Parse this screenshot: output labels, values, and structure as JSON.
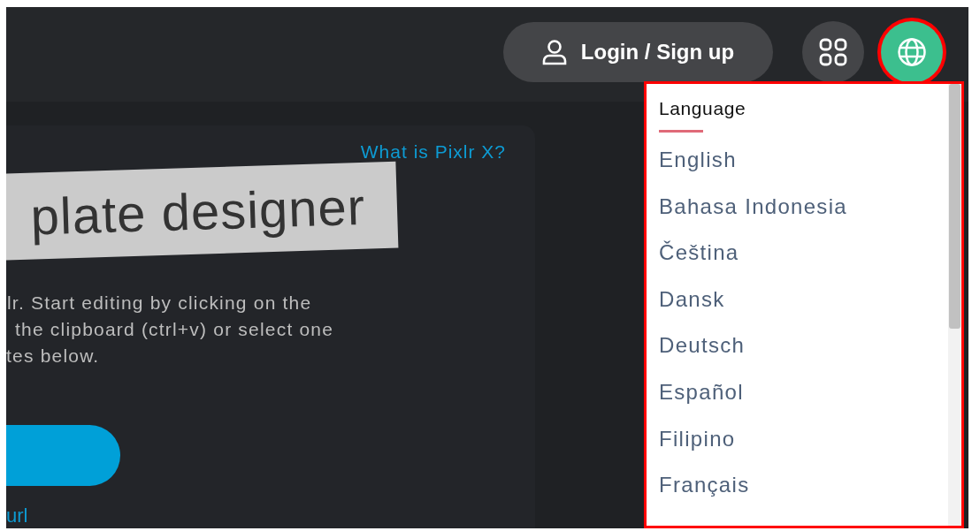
{
  "header": {
    "login_button": "Login / Sign up",
    "language_button": {
      "highlighted": true
    }
  },
  "intro": {
    "help_link": "What is Pixlr X?",
    "title": "plate designer",
    "description_lines": [
      "lr. Start editing by clicking on the",
      "the clipboard (ctrl+v) or select one",
      "tes below."
    ],
    "url_link": "url"
  },
  "language_menu": {
    "highlighted": true,
    "heading": "Language",
    "items": [
      {
        "label": "English"
      },
      {
        "label": "Bahasa Indonesia"
      },
      {
        "label": "Čeština"
      },
      {
        "label": "Dansk"
      },
      {
        "label": "Deutsch"
      },
      {
        "label": "Español"
      },
      {
        "label": "Filipino"
      },
      {
        "label": "Français"
      }
    ]
  }
}
